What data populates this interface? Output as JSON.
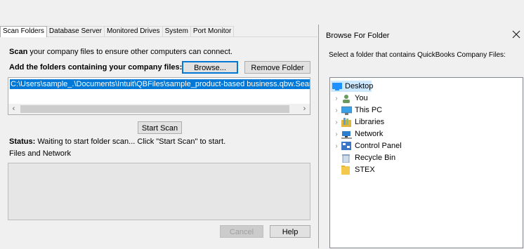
{
  "tabs": [
    "Scan Folders",
    "Database Server",
    "Monitored Drives",
    "System",
    "Port Monitor"
  ],
  "scan": {
    "intro_bold": "Scan",
    "intro_rest": " your company files to ensure other computers can connect.",
    "add_label": "Add the folders containing your company files:",
    "browse_label": "Browse...",
    "remove_label": "Remove Folder",
    "folder_path": "C:\\Users\\sample_.\\Documents\\Intuit\\QBFiles\\sample_product-based business.qbw.Search",
    "start_scan_label": "Start Scan",
    "status_label": "Status:",
    "status_text": " Waiting to start folder scan... Click \"Start Scan\" to start.",
    "files_label": "Files and Network",
    "cancel_label": "Cancel",
    "help_label": "Help"
  },
  "dialog": {
    "title": "Browse For Folder",
    "instruction": "Select a folder that contains QuickBooks Company Files:",
    "tree": [
      {
        "label": "Desktop",
        "icon": "desktop-icon",
        "expandable": false,
        "selected": true,
        "color": "#1e90ff"
      },
      {
        "label": "You",
        "icon": "user-icon",
        "expandable": true,
        "selected": false,
        "color": "#6a9a5b"
      },
      {
        "label": "This PC",
        "icon": "computer-icon",
        "expandable": true,
        "selected": false,
        "color": "#3aa0e8"
      },
      {
        "label": "Libraries",
        "icon": "libraries-icon",
        "expandable": true,
        "selected": false,
        "color": "#e2b441"
      },
      {
        "label": "Network",
        "icon": "network-icon",
        "expandable": true,
        "selected": false,
        "color": "#2f7fd1"
      },
      {
        "label": "Control Panel",
        "icon": "control-panel-icon",
        "expandable": true,
        "selected": false,
        "color": "#3b77c4"
      },
      {
        "label": "Recycle Bin",
        "icon": "recycle-bin-icon",
        "expandable": false,
        "selected": false,
        "color": "#8aa4c0"
      },
      {
        "label": "STEX",
        "icon": "folder-icon",
        "expandable": false,
        "selected": false,
        "color": "#f2c94c"
      }
    ]
  }
}
